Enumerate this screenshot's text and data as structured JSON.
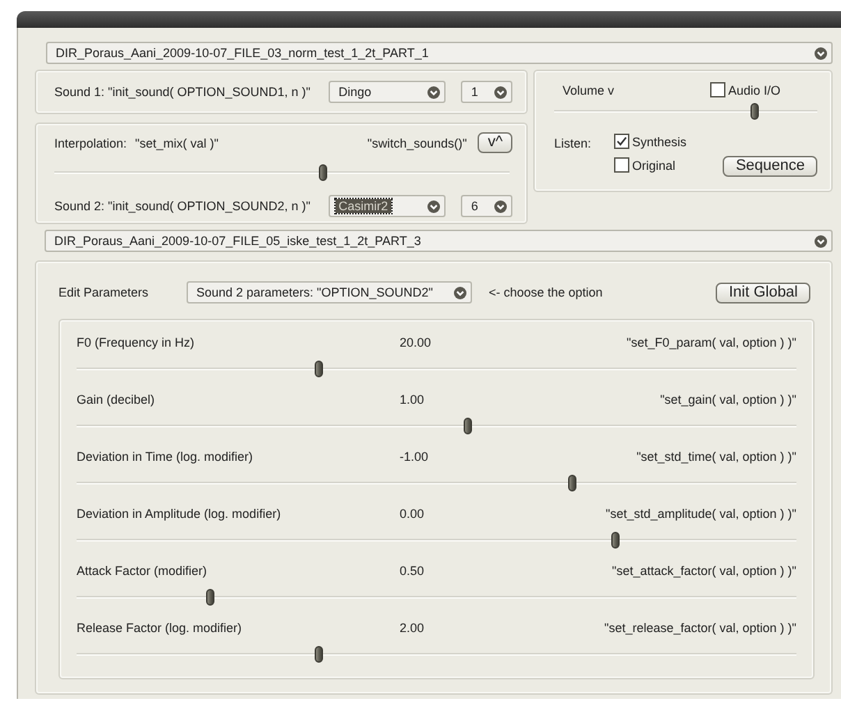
{
  "file_1": {
    "value": "DIR_Poraus_Aani_2009-10-07_FILE_03_norm_test_1_2t_PART_1"
  },
  "sound_1": {
    "label": "Sound 1: \"init_sound( OPTION_SOUND1, n )\"",
    "sound": {
      "value": "Dingo",
      "focused": false
    },
    "number": {
      "value": "1",
      "focused": false
    }
  },
  "interpolation": {
    "label": "Interpolation:",
    "function": "\"set_mix( val )\"",
    "switch_label": "\"switch_sounds()\"",
    "switch_button": "v^",
    "level": 0.59
  },
  "sound_2": {
    "label": "Sound 2: \"init_sound( OPTION_SOUND2, n )\"",
    "sound": {
      "value": "Casimir2",
      "focused": true
    },
    "number": {
      "value": "6",
      "focused": false
    }
  },
  "volume": {
    "label": "Volume v",
    "level": 0.76
  },
  "audio_io": {
    "label": "Audio I/O",
    "checked": false
  },
  "listen": {
    "label": "Listen:",
    "options": [
      {
        "label": "Synthesis",
        "checked": true
      },
      {
        "label": "Original",
        "checked": false
      }
    ],
    "sequence_button": "Sequence"
  },
  "file_2": {
    "value": "DIR_Poraus_Aani_2009-10-07_FILE_05_iske_test_1_2t_PART_3"
  },
  "edit": {
    "label": "Edit Parameters",
    "option": {
      "value": "Sound 2 parameters: \"OPTION_SOUND2\"",
      "focused": false
    },
    "hint": "<- choose the option",
    "init_button": "Init Global"
  },
  "parameters": [
    {
      "name": "F0 (Frequency in Hz)",
      "value": "20.00",
      "function": "\"set_F0_param( val, option ) )\"",
      "level": 0.337
    },
    {
      "name": "Gain (decibel)",
      "value": "1.00",
      "function": "\"set_gain( val, option ) )\"",
      "level": 0.543
    },
    {
      "name": "Deviation in Time (log. modifier)",
      "value": "-1.00",
      "function": "\"set_std_time( val, option ) )\"",
      "level": 0.688
    },
    {
      "name": "Deviation in Amplitude (log. modifier)",
      "value": "0.00",
      "function": "\"set_std_amplitude( val, option ) )\"",
      "level": 0.749
    },
    {
      "name": "Attack Factor (modifier)",
      "value": "0.50",
      "function": "\"set_attack_factor( val, option ) )\"",
      "level": 0.185
    },
    {
      "name": "Release Factor (log. modifier)",
      "value": "2.00",
      "function": "\"set_release_factor( val, option ) )\"",
      "level": 0.337
    }
  ]
}
